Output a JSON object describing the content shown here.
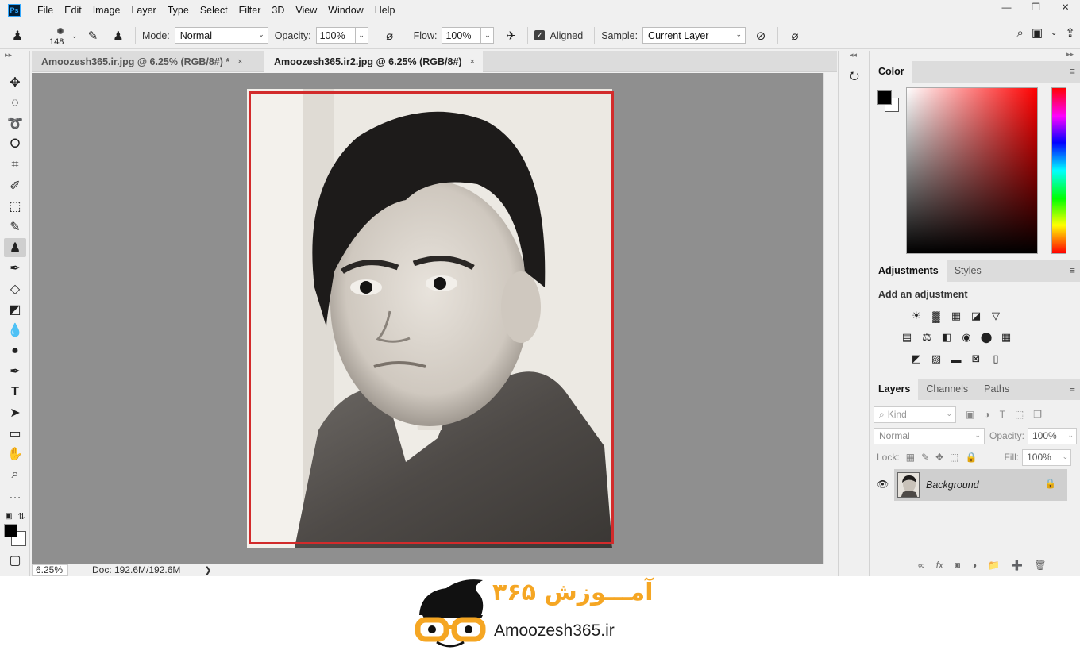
{
  "app": {
    "logo": "Ps"
  },
  "menu": [
    "File",
    "Edit",
    "Image",
    "Layer",
    "Type",
    "Select",
    "Filter",
    "3D",
    "View",
    "Window",
    "Help"
  ],
  "options": {
    "brush_size": "148",
    "mode_label": "Mode:",
    "mode_value": "Normal",
    "opacity_label": "Opacity:",
    "opacity_value": "100%",
    "flow_label": "Flow:",
    "flow_value": "100%",
    "aligned_label": "Aligned",
    "sample_label": "Sample:",
    "sample_value": "Current Layer"
  },
  "tabs": [
    {
      "label": "Amoozesh365.ir.jpg @ 6.25% (RGB/8#) *",
      "close": "×"
    },
    {
      "label": "Amoozesh365.ir2.jpg @ 6.25% (RGB/8#)",
      "close": "×"
    }
  ],
  "status": {
    "zoom": "6.25%",
    "doc": "Doc: 192.6M/192.6M",
    "arrow": "❯"
  },
  "panels": {
    "color_tab": "Color",
    "adjustments_tab": "Adjustments",
    "styles_tab": "Styles",
    "adjustments_title": "Add an adjustment",
    "layers_tab": "Layers",
    "channels_tab": "Channels",
    "paths_tab": "Paths"
  },
  "layers": {
    "kind_placeholder": "Kind",
    "blend_mode": "Normal",
    "opacity_label": "Opacity:",
    "opacity_value": "100%",
    "lock_label": "Lock:",
    "fill_label": "Fill:",
    "fill_value": "100%",
    "layer_name": "Background"
  },
  "watermark": {
    "url": "Amoozesh365.ir",
    "persian": "آمـــوزش ۳۶۵"
  },
  "colors": {
    "accent": "#d22b2b",
    "logo_orange": "#f5a623",
    "canvas_bg": "#8f8f8f"
  }
}
